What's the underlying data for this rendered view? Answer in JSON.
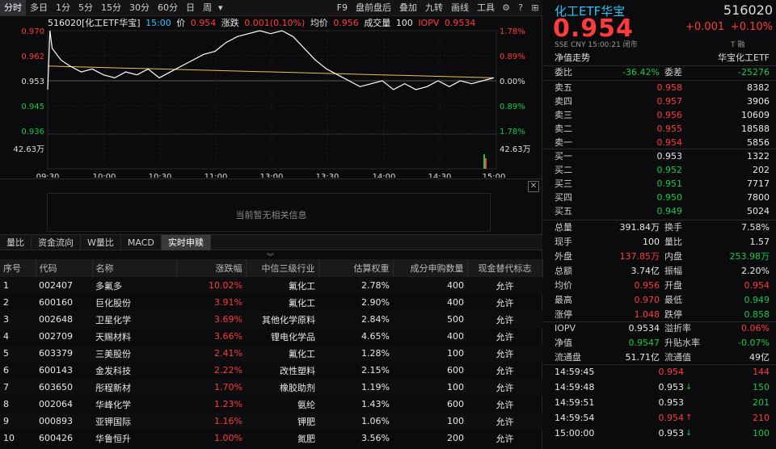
{
  "toolbar": {
    "left": [
      "分时",
      "多日",
      "1分",
      "5分",
      "15分",
      "30分",
      "60分",
      "日",
      "周"
    ],
    "right": [
      "F9",
      "盘前盘后",
      "叠加",
      "九转",
      "画线",
      "工具"
    ]
  },
  "infobar": {
    "name": "516020[化工ETF华宝]",
    "time": "15:00",
    "price_label": "价",
    "price": "0.954",
    "chg_label": "涨跌",
    "chg": "0.001(0.10%)",
    "avg_label": "均价",
    "avg": "0.956",
    "vol_label": "成交量",
    "vol": "100",
    "iopv_label": "IOPV",
    "iopv": "0.9534"
  },
  "chart_axis": {
    "left_ticks": [
      "0.970",
      "0.962",
      "0.953",
      "0.945",
      "0.936"
    ],
    "right_ticks": [
      "1.78%",
      "0.89%",
      "0.00%",
      "0.89%",
      "1.78%"
    ],
    "vol_left": "42.63万",
    "vol_right": "42.63万",
    "time_ticks": [
      "09:30",
      "10:00",
      "10:30",
      "11:00",
      "13:00",
      "13:30",
      "14:00",
      "14:30",
      "15:00"
    ]
  },
  "empty_panel": {
    "message": "当前暂无相关信息"
  },
  "tabs": [
    "量比",
    "资金流向",
    "W量比",
    "MACD",
    "实时申赎"
  ],
  "table": {
    "headers": [
      "序号",
      "代码",
      "名称",
      "涨跌幅",
      "中信三级行业",
      "估算权重",
      "成分申购数量",
      "现金替代标志"
    ],
    "rows": [
      [
        "1",
        "002407",
        "多氟多",
        "10.02%",
        "氟化工",
        "2.78%",
        "400",
        "允许"
      ],
      [
        "2",
        "600160",
        "巨化股份",
        "3.91%",
        "氟化工",
        "2.90%",
        "400",
        "允许"
      ],
      [
        "3",
        "002648",
        "卫星化学",
        "3.69%",
        "其他化学原料",
        "2.84%",
        "500",
        "允许"
      ],
      [
        "4",
        "002709",
        "天赐材料",
        "3.66%",
        "锂电化学品",
        "4.65%",
        "400",
        "允许"
      ],
      [
        "5",
        "603379",
        "三美股份",
        "2.41%",
        "氟化工",
        "1.28%",
        "100",
        "允许"
      ],
      [
        "6",
        "600143",
        "金发科技",
        "2.22%",
        "改性塑料",
        "2.15%",
        "600",
        "允许"
      ],
      [
        "7",
        "603650",
        "彤程新材",
        "1.70%",
        "橡胶助剂",
        "1.19%",
        "100",
        "允许"
      ],
      [
        "8",
        "002064",
        "华峰化学",
        "1.23%",
        "氨纶",
        "1.43%",
        "600",
        "允许"
      ],
      [
        "9",
        "000893",
        "亚钾国际",
        "1.16%",
        "钾肥",
        "1.06%",
        "100",
        "允许"
      ],
      [
        "10",
        "600426",
        "华鲁恒升",
        "1.00%",
        "氮肥",
        "3.56%",
        "200",
        "允许"
      ]
    ]
  },
  "quote": {
    "title": "化工ETF华宝",
    "code": "516020",
    "price": "0.954",
    "chg": "+0.001",
    "chg_pct": "+0.10%",
    "meta": "SSE  CNY  15:00:21  闭市",
    "meta2": "T  融",
    "nav_trend": "净值走势",
    "issuer": "华宝化工ETF",
    "weibi_label": "委比",
    "weibi": "-36.42%",
    "weicha_label": "委差",
    "weicha": "-25276"
  },
  "orderbook": {
    "asks": [
      {
        "label": "卖五",
        "price": "0.958",
        "vol": "8382"
      },
      {
        "label": "卖四",
        "price": "0.957",
        "vol": "3906"
      },
      {
        "label": "卖三",
        "price": "0.956",
        "vol": "10609"
      },
      {
        "label": "卖二",
        "price": "0.955",
        "vol": "18588"
      },
      {
        "label": "卖一",
        "price": "0.954",
        "vol": "5856"
      }
    ],
    "bids": [
      {
        "label": "买一",
        "price": "0.953",
        "vol": "1322"
      },
      {
        "label": "买二",
        "price": "0.952",
        "vol": "202"
      },
      {
        "label": "买三",
        "price": "0.951",
        "vol": "7717"
      },
      {
        "label": "买四",
        "price": "0.950",
        "vol": "7800"
      },
      {
        "label": "买五",
        "price": "0.949",
        "vol": "5024"
      }
    ]
  },
  "stats": [
    {
      "l1": "总量",
      "v1": "391.84万",
      "c1": "white",
      "l2": "换手",
      "v2": "7.58%",
      "c2": "white"
    },
    {
      "l1": "现手",
      "v1": "100",
      "c1": "white",
      "l2": "量比",
      "v2": "1.57",
      "c2": "white"
    },
    {
      "l1": "外盘",
      "v1": "137.85万",
      "c1": "red",
      "l2": "内盘",
      "v2": "253.98万",
      "c2": "green"
    },
    {
      "l1": "总额",
      "v1": "3.74亿",
      "c1": "white",
      "l2": "振幅",
      "v2": "2.20%",
      "c2": "white"
    },
    {
      "l1": "均价",
      "v1": "0.956",
      "c1": "red",
      "l2": "开盘",
      "v2": "0.954",
      "c2": "red"
    },
    {
      "l1": "最高",
      "v1": "0.970",
      "c1": "red",
      "l2": "最低",
      "v2": "0.949",
      "c2": "green"
    },
    {
      "l1": "涨停",
      "v1": "1.048",
      "c1": "red",
      "l2": "跌停",
      "v2": "0.858",
      "c2": "green"
    }
  ],
  "stats2": [
    {
      "l1": "IOPV",
      "v1": "0.9534",
      "c1": "white",
      "l2": "溢折率",
      "v2": "0.06%",
      "c2": "red"
    },
    {
      "l1": "净值",
      "v1": "0.9547",
      "c1": "green",
      "l2": "升贴水率",
      "v2": "-0.07%",
      "c2": "green"
    },
    {
      "l1": "流通盘",
      "v1": "51.71亿",
      "c1": "white",
      "l2": "流通值",
      "v2": "49亿",
      "c2": "white"
    }
  ],
  "ticks": [
    {
      "time": "14:59:45",
      "price": "0.954",
      "pc": "red",
      "arrow": "",
      "vol": "144",
      "vc": "red"
    },
    {
      "time": "14:59:48",
      "price": "0.953",
      "pc": "white",
      "arrow": "↓",
      "vol": "150",
      "vc": "green"
    },
    {
      "time": "14:59:51",
      "price": "0.953",
      "pc": "white",
      "arrow": "",
      "vol": "201",
      "vc": "green"
    },
    {
      "time": "14:59:54",
      "price": "0.954",
      "pc": "red",
      "arrow": "↑",
      "vol": "210",
      "vc": "red"
    },
    {
      "time": "15:00:00",
      "price": "0.953",
      "pc": "white",
      "arrow": "↓",
      "vol": "100",
      "vc": "green"
    }
  ],
  "colors": {
    "up": "#ff3b3b",
    "down": "#16c94a",
    "accent": "#29c5f6",
    "avgline": "#e8c34a",
    "priceline": "#ffffff"
  }
}
